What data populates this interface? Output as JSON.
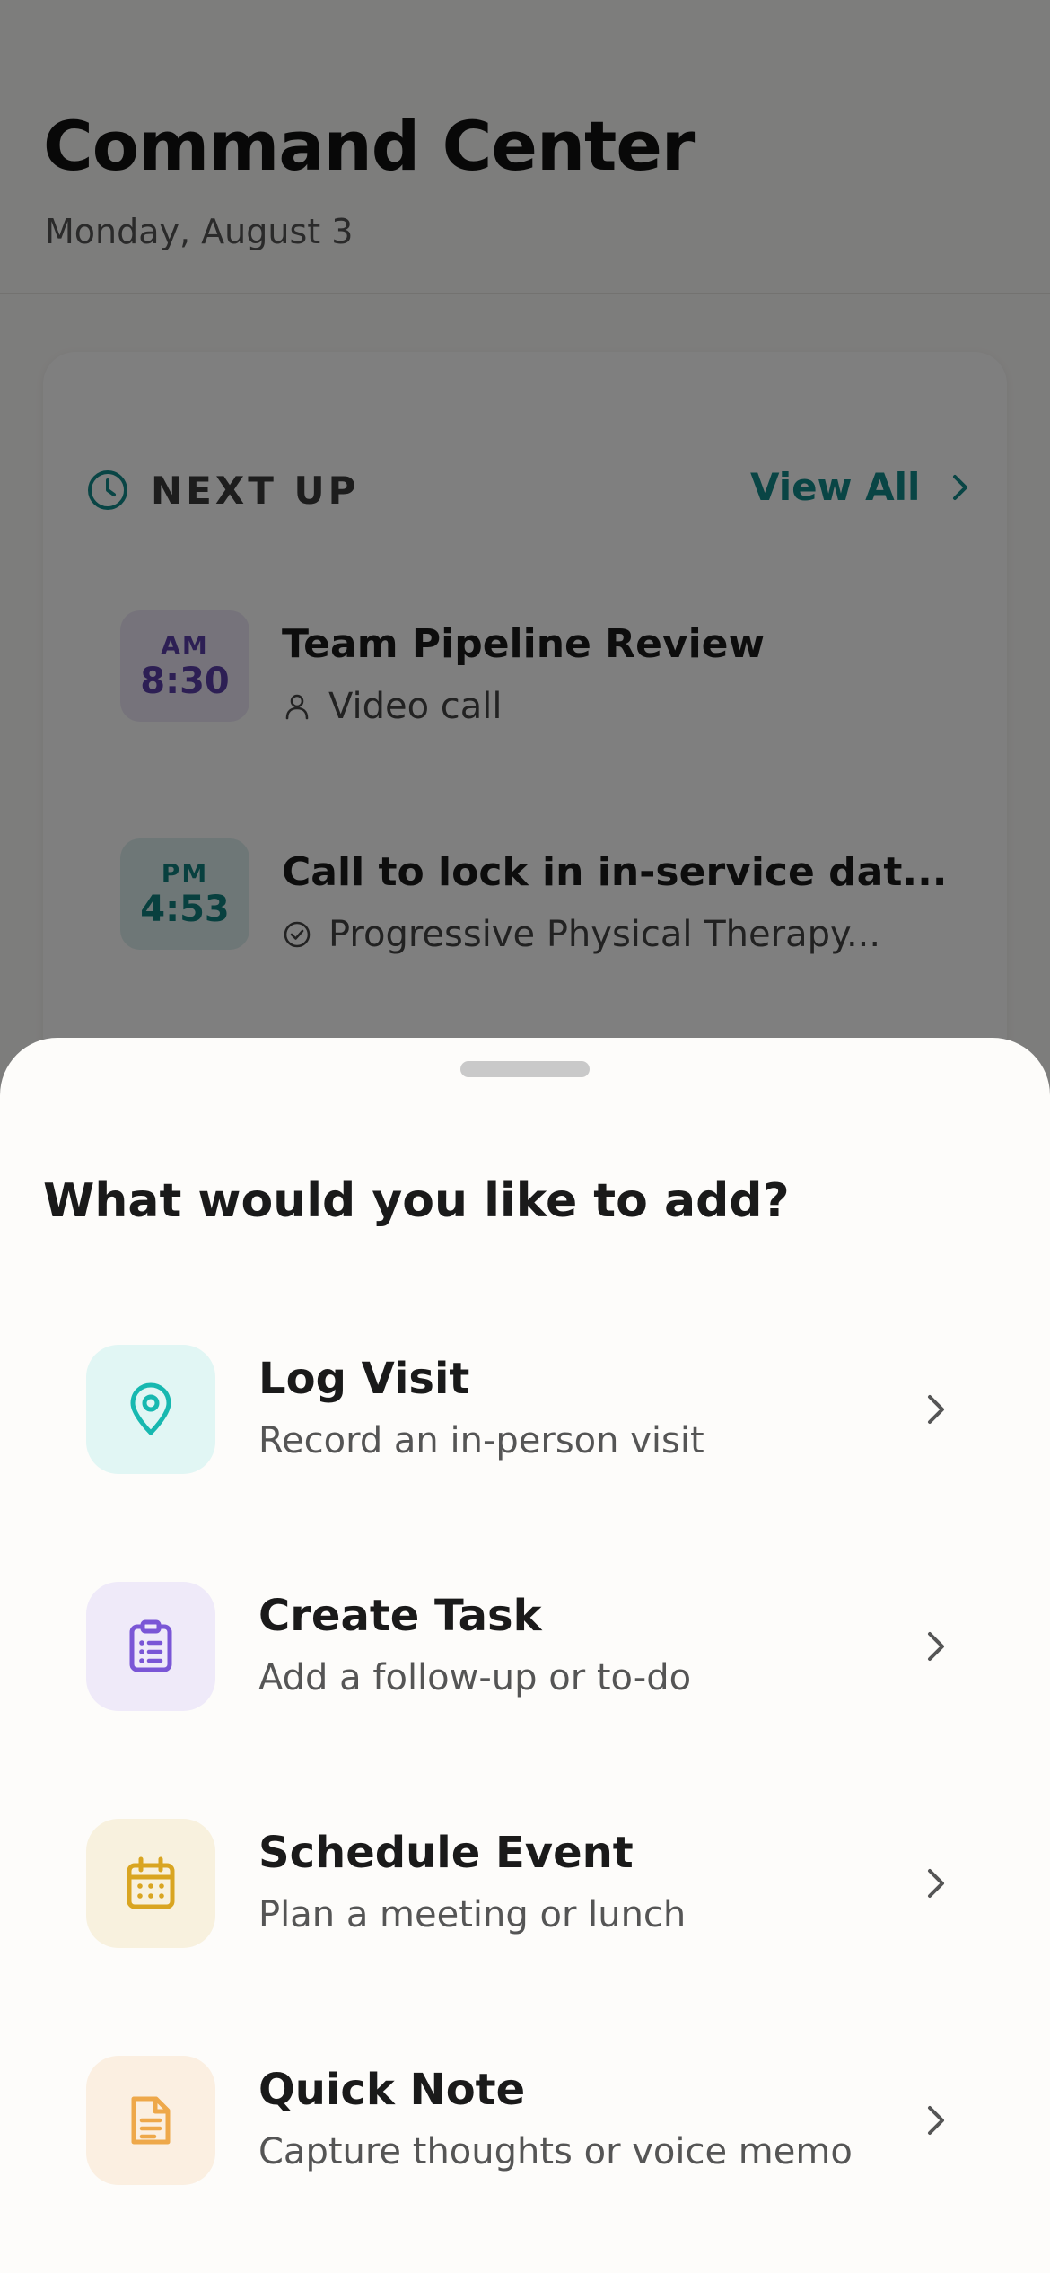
{
  "header": {
    "title": "Command Center",
    "date": "Monday, August 3"
  },
  "next_up": {
    "label": "NEXT UP",
    "view_all": "View All",
    "events": [
      {
        "ampm": "AM",
        "time": "8:30",
        "title": "Team Pipeline Review",
        "subtitle": "Video call",
        "color": "#5b3fa8"
      },
      {
        "ampm": "PM",
        "time": "4:53",
        "title": "Call to lock in in-service dat...",
        "subtitle": "Progressive Physical Therapy...",
        "color": "#10807f"
      }
    ]
  },
  "sheet": {
    "title": "What would you like to add?",
    "options": [
      {
        "title": "Log Visit",
        "subtitle": "Record an in-person visit",
        "icon": "map-pin-icon",
        "color": "#17b8b0",
        "bg": "#e1f6f4"
      },
      {
        "title": "Create Task",
        "subtitle": "Add a follow-up or to-do",
        "icon": "clipboard-list-icon",
        "color": "#7a56d6",
        "bg": "#efeaf9"
      },
      {
        "title": "Schedule Event",
        "subtitle": "Plan a meeting or lunch",
        "icon": "calendar-icon",
        "color": "#d9a521",
        "bg": "#f8f1de"
      },
      {
        "title": "Quick Note",
        "subtitle": "Capture thoughts or voice memo",
        "icon": "document-icon",
        "color": "#eea84a",
        "bg": "#fbefe1"
      }
    ]
  },
  "colors": {
    "accent_teal": "#128a8a",
    "scrim": "rgba(0,0,0,0.5)"
  }
}
